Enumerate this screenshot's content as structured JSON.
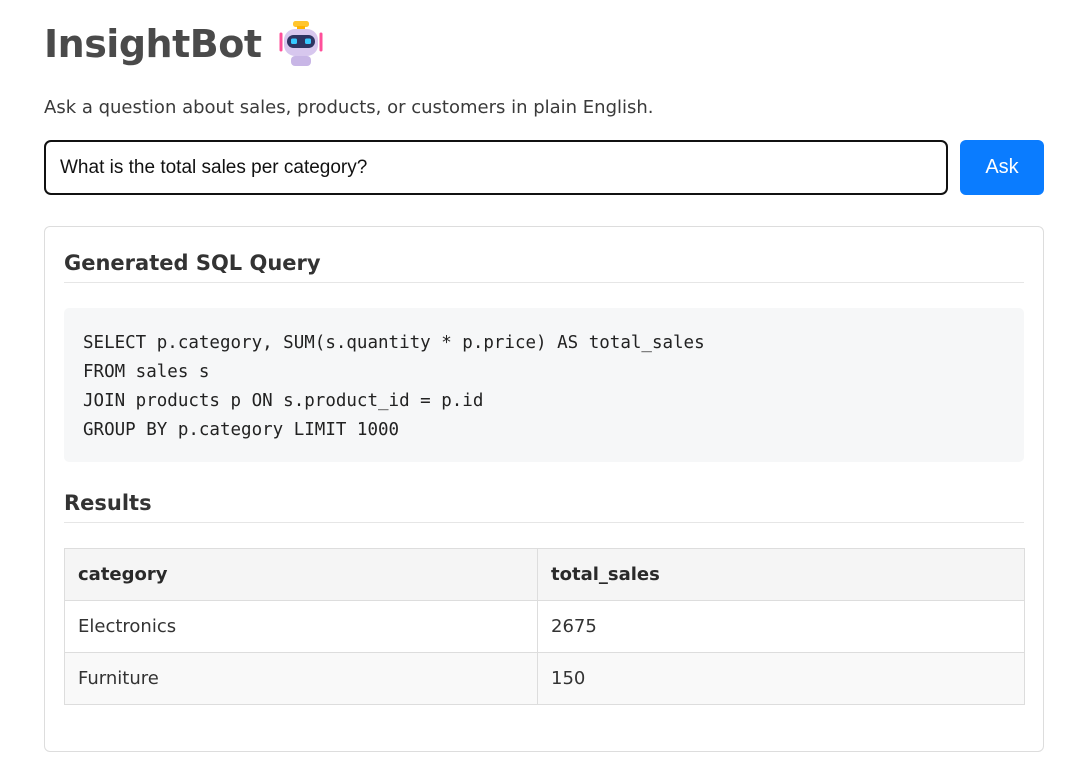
{
  "header": {
    "title": "InsightBot",
    "icon": "robot-icon",
    "subtitle": "Ask a question about sales, products, or customers in plain English."
  },
  "query_form": {
    "input_value": "What is the total sales per category?",
    "ask_label": "Ask"
  },
  "sql_section": {
    "heading": "Generated SQL Query",
    "lines": [
      "SELECT p.category, SUM(s.quantity * p.price) AS total_sales",
      "FROM sales s",
      "JOIN products p ON s.product_id = p.id",
      "GROUP BY p.category LIMIT 1000"
    ]
  },
  "results_section": {
    "heading": "Results",
    "columns": [
      "category",
      "total_sales"
    ],
    "rows": [
      [
        "Electronics",
        "2675"
      ],
      [
        "Furniture",
        "150"
      ]
    ]
  },
  "colors": {
    "accent": "#0a7cff",
    "title": "#4a4a4a",
    "code_background": "#f6f7f8",
    "table_header_background": "#f5f5f5"
  }
}
